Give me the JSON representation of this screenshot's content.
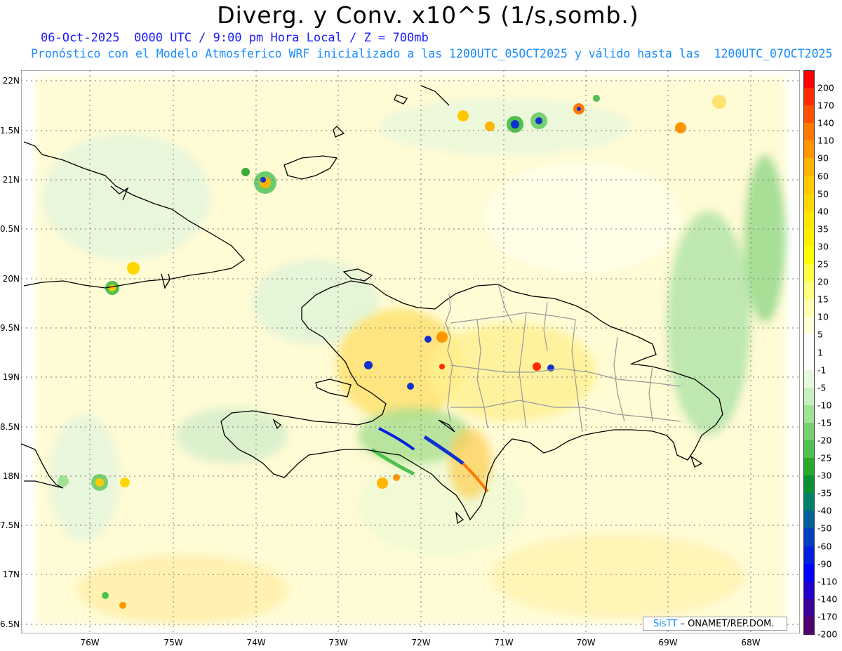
{
  "header": {
    "title": "Diverg. y Conv. x10^5 (1/s,somb.)",
    "subtitle_1": "06-Oct-2025  0000 UTC / 9:00 pm Hora Local / Z = 700mb",
    "subtitle_2": "Pronóstico con el Modelo Atmosferico WRF inicializado a las 1200UTC_05OCT2025 y válido hasta las  1200UTC_07OCT2025"
  },
  "axes": {
    "lat_labels": [
      "22N",
      "1.5N",
      "21N",
      "0.5N",
      "20N",
      "9.5N",
      "19N",
      "8.5N",
      "18N",
      "7.5N",
      "17N",
      "6.5N"
    ],
    "lon_labels": [
      "76W",
      "75W",
      "74W",
      "73W",
      "72W",
      "71W",
      "70W",
      "69W",
      "68W"
    ]
  },
  "colorbar": {
    "labels": [
      "200",
      "170",
      "140",
      "110",
      "90",
      "60",
      "50",
      "40",
      "35",
      "30",
      "25",
      "20",
      "15",
      "10",
      "5",
      "1",
      "-1",
      "-5",
      "-10",
      "-15",
      "-20",
      "-25",
      "-30",
      "-35",
      "-40",
      "-50",
      "-60",
      "-90",
      "-110",
      "-140",
      "-170",
      "-200"
    ],
    "colors": [
      "#ff0000",
      "#ff2a00",
      "#ff5000",
      "#ff7800",
      "#ff9600",
      "#ffb400",
      "#ffc800",
      "#ffd700",
      "#ffe600",
      "#fff000",
      "#ffff00",
      "#ffff44",
      "#ffff80",
      "#ffffb0",
      "#ffffd8",
      "#ffffff",
      "#ffffff",
      "#e8f8e0",
      "#c8efc0",
      "#a0e296",
      "#78d070",
      "#50c050",
      "#2aaa2a",
      "#0a9030",
      "#00806a",
      "#00609a",
      "#0040c0",
      "#0020e0",
      "#0000ff",
      "#2000c8",
      "#3c0096",
      "#50006e"
    ]
  },
  "credit": {
    "brand": "SisTT",
    "org": "– ONAMET/REP.DOM."
  }
}
